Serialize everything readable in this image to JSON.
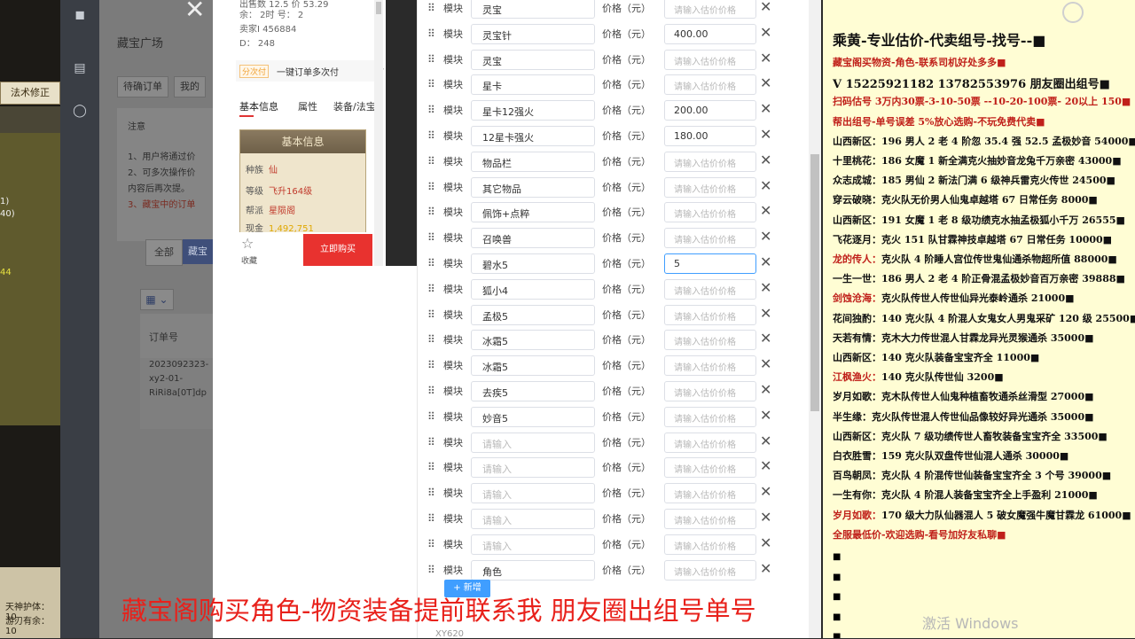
{
  "game": {
    "tab_label": "法术修正",
    "left_values": [
      "1)",
      "40)",
      "44"
    ],
    "bottom_lines": [
      "天神护体：10",
      "游刃有余：10"
    ]
  },
  "web": {
    "page_title": "藏宝广场",
    "tabs": [
      "待确订单",
      "我的"
    ],
    "notice_title": "注意",
    "notice_lines": [
      "1、用户将通过价",
      "2、可多次操作价",
      "内容后再次提。",
      "3、藏宝中的订单"
    ],
    "filter_all": "全部",
    "filter_active": "藏宝",
    "grid_icon": "grid-icon",
    "order_header": "订单号",
    "order_lines": [
      "2023092323-",
      "xy2-01-",
      "RiRi8a[0T]dp"
    ]
  },
  "product": {
    "meta_lines": [
      "出售数  12.5    价  53.29",
      "余：    2时    号：    2",
      "卖家I   456884",
      "D：    248"
    ],
    "promo_badge": "分次付",
    "promo_text": "一键订单多次付",
    "info_tabs": [
      "基本信息",
      "属性",
      "装备/法宝"
    ],
    "card_title": "基本信息",
    "rows": [
      {
        "label": "种族",
        "value": "仙"
      },
      {
        "label": "等级",
        "value": "飞升164级"
      },
      {
        "label": "帮派",
        "value": "星陨阁"
      },
      {
        "label": "现金",
        "value": "1,492,751"
      }
    ],
    "fav_label": "收藏",
    "buy_label": "立即购买"
  },
  "form": {
    "module_label": "模块",
    "price_label": "价格（元）",
    "name_placeholder": "请输入",
    "price_placeholder": "请输入估价价格",
    "rows": [
      {
        "name": "灵宝",
        "price": ""
      },
      {
        "name": "灵宝针",
        "price": "400.00"
      },
      {
        "name": "灵宝",
        "price": ""
      },
      {
        "name": "星卡",
        "price": ""
      },
      {
        "name": "星卡12强火",
        "price": "200.00"
      },
      {
        "name": "12星卡强火",
        "price": "180.00"
      },
      {
        "name": "物品栏",
        "price": ""
      },
      {
        "name": "其它物品",
        "price": ""
      },
      {
        "name": "佩饰+点粹",
        "price": ""
      },
      {
        "name": "召唤兽",
        "price": ""
      },
      {
        "name": "碧水5",
        "price": "5"
      },
      {
        "name": "狐小4",
        "price": ""
      },
      {
        "name": "孟极5",
        "price": ""
      },
      {
        "name": "冰霜5",
        "price": ""
      },
      {
        "name": "冰霜5",
        "price": ""
      },
      {
        "name": "去疾5",
        "price": ""
      },
      {
        "name": "妙音5",
        "price": ""
      },
      {
        "name": "",
        "price": ""
      },
      {
        "name": "",
        "price": ""
      },
      {
        "name": "",
        "price": ""
      },
      {
        "name": "",
        "price": ""
      },
      {
        "name": "",
        "price": ""
      },
      {
        "name": "角色",
        "price": ""
      }
    ],
    "focused_row": 10,
    "add_label": "+ 新增",
    "bottom_stub": "XY620"
  },
  "overlay": {
    "headline": "乘黄-专业估价-代卖组号-找号--■",
    "lines": [
      {
        "text": "藏宝阁买物资-角色-联系司机好处多多■",
        "style": "red"
      },
      {
        "text": "V 15225921182   13782553976 朋友圈出组号■",
        "style": "big"
      },
      {
        "text": "扫码估号 3万内30票-3-10-50票 --10-20-100票- 20以上 150■",
        "style": "red"
      },
      {
        "text": "帮出组号-单号误差 5%放心选购-不玩免费代卖■",
        "style": "red"
      },
      {
        "loc": "山西新区：",
        "text": "196 男人 2 老 4 阶忽 35.4 强 52.5 孟极妙音 54000■"
      },
      {
        "loc": "十里桃花：",
        "text": "186 女魔 1 新全满克火抽妙音龙兔千万亲密 43000■"
      },
      {
        "loc": "众志成城：",
        "text": "185 男仙 2 新法门满 6 级神兵雷克火传世 24500■"
      },
      {
        "loc": "穿云破晓：",
        "text": "克火队无价男人仙鬼卓越塔 67 日常任务 8000■"
      },
      {
        "loc": "山西新区：",
        "text": "191 女魔 1 老 8 级功绩克水抽孟极狐小千万 26555■"
      },
      {
        "loc": "飞花逐月：",
        "text": "克火 151 队甘霖神技卓越塔 67 日常任务 10000■"
      },
      {
        "loc": "龙的传人：",
        "text": "克火队 4 阶睡人宫位传世鬼仙通杀物超所值 88000■",
        "red": true
      },
      {
        "loc": "一生一世：",
        "text": "186 男人 2 老 4 阶正骨混孟极妙音百万亲密 39888■"
      },
      {
        "loc": "剑蚀沧海：",
        "text": "克火队传世人传世仙异光泰岭通杀 21000■",
        "red": true
      },
      {
        "loc": "花间独酌：",
        "text": "140 克火队 4 阶混人女鬼女人男鬼采矿 120 级 25500■"
      },
      {
        "loc": "天若有情：",
        "text": "克木大力传世混人甘霖龙异光灵猴通杀 35000■"
      },
      {
        "loc": "山西新区：",
        "text": "140 克火队装备宝宝齐全 11000■"
      },
      {
        "loc": "江枫渔火：",
        "text": "140 克火队传世仙 3200■",
        "red": true
      },
      {
        "loc": "岁月如歌：",
        "text": "克木队传世人仙鬼种植畜牧通杀丝滑型 27000■"
      },
      {
        "loc": "半生缘：",
        "text": "克火队传世混人传世仙品像较好异光通杀 35000■"
      },
      {
        "loc": "山西新区：",
        "text": "克火队 7 级功绩传世人畜牧装备宝宝齐全 33500■"
      },
      {
        "loc": "白衣胜雪：",
        "text": "159 克火队双盘传世仙混人通杀 30000■"
      },
      {
        "loc": "百鸟朝凤：",
        "text": "克火队 4 阶混传世仙装备宝宝齐全 3 个号 39000■"
      },
      {
        "loc": "一生有你：",
        "text": "克火队 4 阶混人装备宝宝齐全上手盈利 21000■"
      },
      {
        "loc": "岁月如歌：",
        "text": "170 级大力队仙器混人 5 破女魔强牛魔甘霖龙 61000■",
        "red": true
      },
      {
        "text": "全服最低价-欢迎选购-看号加好友私聊■",
        "style": "red"
      }
    ],
    "bullets": [
      "■",
      "■",
      "■",
      "■",
      "■",
      "■"
    ]
  },
  "caption": "藏宝阁购买角色-物资装备提前联系我      朋友圈出组号单号",
  "watermark": "激活 Windows"
}
